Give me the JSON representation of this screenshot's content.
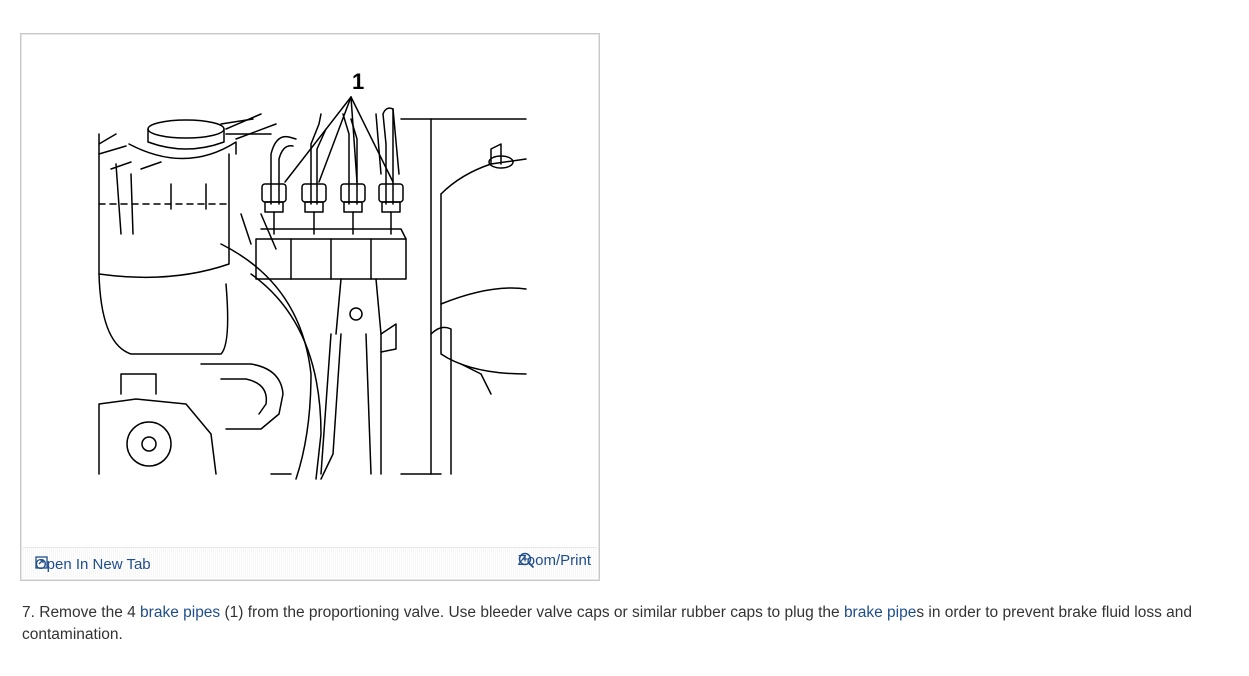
{
  "figure": {
    "callout_label": "1",
    "open_tab_label": "Open In New Tab",
    "zoom_label": "Zoom/Print",
    "open_tab_icon": "open-new-tab-icon",
    "zoom_icon": "zoom-magnifier-icon"
  },
  "step": {
    "number": "7.",
    "text_1": " Remove the 4 ",
    "link_1": "brake pipes",
    "text_2": " (1) from the proportioning valve. Use bleeder valve caps or similar rubber caps to plug the ",
    "link_2": "brake pipe",
    "text_3": "s in order to prevent brake fluid loss and contamination."
  },
  "colors": {
    "link": "#1f4e8c",
    "text": "#333333",
    "frame_border": "#c8c8c8"
  }
}
